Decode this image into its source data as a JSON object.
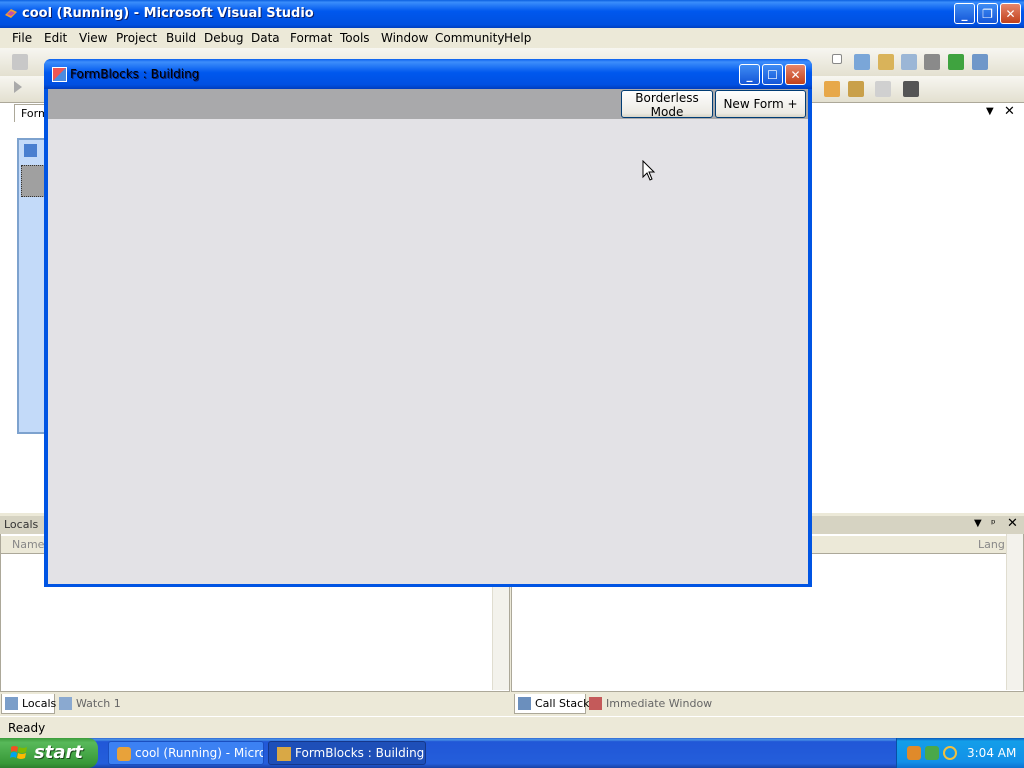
{
  "vs": {
    "title": "cool (Running) - Microsoft Visual Studio",
    "menu": [
      "File",
      "Edit",
      "View",
      "Project",
      "Build",
      "Debug",
      "Data",
      "Format",
      "Tools",
      "Window",
      "Community",
      "Help"
    ],
    "doc_tab": "Form",
    "status": "Ready"
  },
  "panes": {
    "locals_title": "Locals",
    "locals_col_name": "Name",
    "callstack_col_lang": "Lang",
    "left_tabs": [
      "Locals",
      "Watch 1"
    ],
    "right_tabs": [
      "Call Stack",
      "Immediate Window"
    ]
  },
  "formblocks": {
    "title": "FormBlocks : Building",
    "borderless_button": "Borderless Mode",
    "new_form_button": "New Form +"
  },
  "taskbar": {
    "start_label": "start",
    "items": [
      "cool (Running) - Micro...",
      "FormBlocks : Building"
    ],
    "clock": "3:04 AM"
  },
  "icons": {
    "minimize": "minimize-icon",
    "maximize": "maximize-icon",
    "restore": "restore-icon",
    "close": "close-icon"
  },
  "colors": {
    "xp_blue": "#0054e3",
    "start_green": "#3c9c3c",
    "form_strip": "#a9a9ab",
    "form_client": "#e3e2e6"
  }
}
